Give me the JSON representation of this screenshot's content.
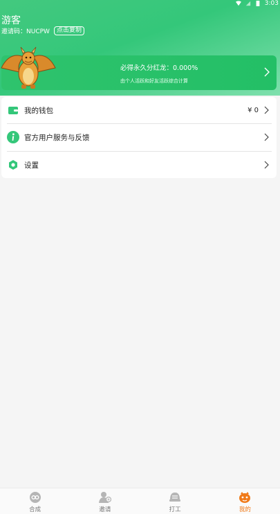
{
  "status_bar": {
    "time": "3:03"
  },
  "profile": {
    "name": "游客",
    "invite_code_label": "邀请码：NUCPW",
    "copy_button": "点击复制"
  },
  "banner": {
    "title": "必得永久分红龙：0.000%",
    "subtitle": "由个人活跃和好友活跃综合计算"
  },
  "menu": [
    {
      "label": "我的钱包",
      "value": "¥ 0",
      "icon": "wallet-icon"
    },
    {
      "label": "官方用户服务与反馈",
      "value": "",
      "icon": "info-icon"
    },
    {
      "label": "设置",
      "value": "",
      "icon": "settings-icon"
    }
  ],
  "tabs": [
    {
      "label": "合成",
      "icon": "merge-icon",
      "active": false
    },
    {
      "label": "邀请",
      "icon": "invite-icon",
      "active": false
    },
    {
      "label": "打工",
      "icon": "helmet-icon",
      "active": false
    },
    {
      "label": "我的",
      "icon": "profile-icon",
      "active": true
    }
  ],
  "colors": {
    "primary_green": "#34c77a",
    "tab_active": "#f07a19",
    "tab_inactive": "#9e9e9e"
  }
}
